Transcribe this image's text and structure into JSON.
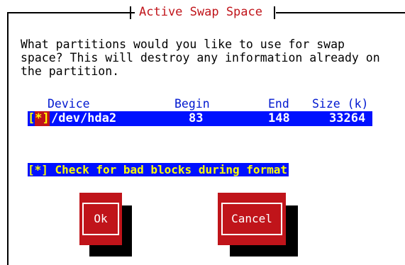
{
  "window": {
    "title": "Active Swap Space"
  },
  "prompt": "What partitions would you like to use for swap\nspace? This will destroy any information already on\nthe partition.",
  "table": {
    "headers": {
      "device": "Device",
      "begin": "Begin",
      "end": "End",
      "size": "Size (k)"
    },
    "rows": [
      {
        "checkbox": "[*]",
        "checked": true,
        "device": "/dev/hda2",
        "begin": "83",
        "end": "148",
        "size": "33264"
      }
    ]
  },
  "bad_blocks": {
    "label": "[*] Check for bad blocks during format",
    "checked": true
  },
  "buttons": {
    "ok": "Ok",
    "cancel": "Cancel"
  },
  "colors": {
    "background": "#ffffff",
    "title": "#c0141a",
    "header": "#0018d0",
    "selection": "#0011ff",
    "button": "#c0141a",
    "checkbox_text": "#ffff00"
  }
}
